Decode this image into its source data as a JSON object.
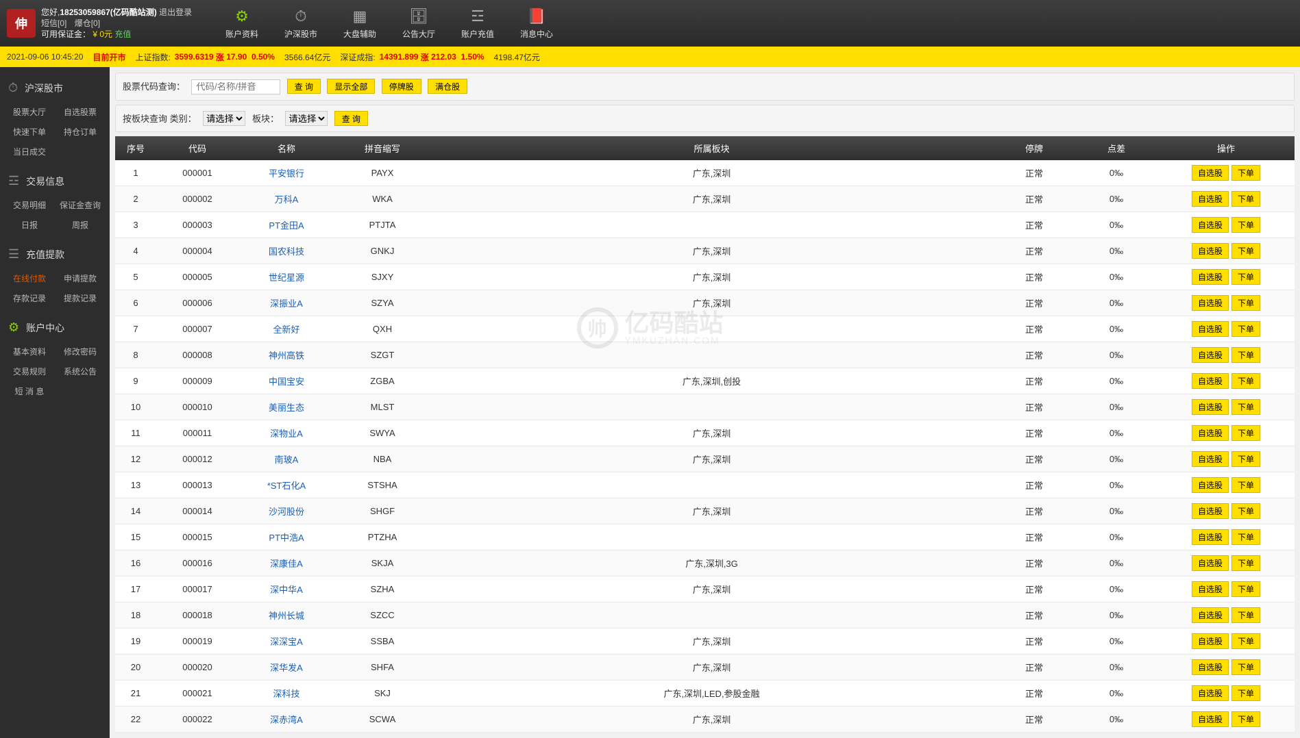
{
  "header": {
    "greeting_prefix": "您好,",
    "username": "18253059867(亿码酷站测)",
    "logout": "退出登录",
    "sms_label": "短信[0]",
    "hold_label": "爆仓[0]",
    "margin_label": "可用保证金：",
    "margin_value": "¥ 0元",
    "recharge": "充值"
  },
  "topnav": [
    {
      "icon": "⚙",
      "label": "账户资料"
    },
    {
      "icon": "⏱",
      "label": "沪深股市"
    },
    {
      "icon": "▦",
      "label": "大盘辅助"
    },
    {
      "icon": "🗄",
      "label": "公告大厅"
    },
    {
      "icon": "☲",
      "label": "账户充值"
    },
    {
      "icon": "📕",
      "label": "消息中心"
    }
  ],
  "ticker": {
    "date_time": "2021-09-06 10:45:20",
    "market_status": "目前开市",
    "sh_label": "上证指数:",
    "sh_index": "3599.6319",
    "sh_up": "涨",
    "sh_chg": "17.90",
    "sh_pct": "0.50%",
    "sh_amt": "3566.64亿元",
    "sz_label": "深证成指:",
    "sz_index": "14391.899",
    "sz_up": "涨",
    "sz_chg": "212.03",
    "sz_pct": "1.50%",
    "sz_amt": "4198.47亿元"
  },
  "sidebar": {
    "cat1": "沪深股市",
    "links1": [
      "股票大厅",
      "自选股票",
      "快速下单",
      "持仓订单",
      "当日成交"
    ],
    "cat2": "交易信息",
    "links2": [
      "交易明细",
      "保证金查询",
      "日报",
      "周报"
    ],
    "cat3": "充值提款",
    "links3": [
      "在线付款",
      "申请提款",
      "存款记录",
      "提款记录"
    ],
    "cat4": "账户中心",
    "links4": [
      "基本资料",
      "修改密码",
      "交易规则",
      "系统公告",
      "短 消 息"
    ]
  },
  "search": {
    "label1": "股票代码查询：",
    "placeholder": "代码/名称/拼音",
    "btn_query": "查 询",
    "btn_all": "显示全部",
    "btn_suspend": "停牌股",
    "btn_full": "满仓股",
    "label2": "按板块查询 类别：",
    "sel1": "请选择",
    "label3": "板块：",
    "sel2": "请选择",
    "btn_query2": "查 询"
  },
  "table": {
    "headers": [
      "序号",
      "代码",
      "名称",
      "拼音缩写",
      "所属板块",
      "停牌",
      "点差",
      "操作"
    ],
    "op_fav": "自选股",
    "op_order": "下单",
    "rows": [
      {
        "n": "1",
        "code": "000001",
        "name": "平安银行",
        "py": "PAYX",
        "sector": "广东,深圳",
        "status": "正常",
        "spread": "0‰"
      },
      {
        "n": "2",
        "code": "000002",
        "name": "万科A",
        "py": "WKA",
        "sector": "广东,深圳",
        "status": "正常",
        "spread": "0‰"
      },
      {
        "n": "3",
        "code": "000003",
        "name": "PT金田A",
        "py": "PTJTA",
        "sector": "",
        "status": "正常",
        "spread": "0‰"
      },
      {
        "n": "4",
        "code": "000004",
        "name": "国农科技",
        "py": "GNKJ",
        "sector": "广东,深圳",
        "status": "正常",
        "spread": "0‰"
      },
      {
        "n": "5",
        "code": "000005",
        "name": "世纪星源",
        "py": "SJXY",
        "sector": "广东,深圳",
        "status": "正常",
        "spread": "0‰"
      },
      {
        "n": "6",
        "code": "000006",
        "name": "深振业A",
        "py": "SZYA",
        "sector": "广东,深圳",
        "status": "正常",
        "spread": "0‰"
      },
      {
        "n": "7",
        "code": "000007",
        "name": "全新好",
        "py": "QXH",
        "sector": "",
        "status": "正常",
        "spread": "0‰"
      },
      {
        "n": "8",
        "code": "000008",
        "name": "神州高铁",
        "py": "SZGT",
        "sector": "",
        "status": "正常",
        "spread": "0‰"
      },
      {
        "n": "9",
        "code": "000009",
        "name": "中国宝安",
        "py": "ZGBA",
        "sector": "广东,深圳,创投",
        "status": "正常",
        "spread": "0‰"
      },
      {
        "n": "10",
        "code": "000010",
        "name": "美丽生态",
        "py": "MLST",
        "sector": "",
        "status": "正常",
        "spread": "0‰"
      },
      {
        "n": "11",
        "code": "000011",
        "name": "深物业A",
        "py": "SWYA",
        "sector": "广东,深圳",
        "status": "正常",
        "spread": "0‰"
      },
      {
        "n": "12",
        "code": "000012",
        "name": "南玻A",
        "py": "NBA",
        "sector": "广东,深圳",
        "status": "正常",
        "spread": "0‰"
      },
      {
        "n": "13",
        "code": "000013",
        "name": "*ST石化A",
        "py": "STSHA",
        "sector": "",
        "status": "正常",
        "spread": "0‰"
      },
      {
        "n": "14",
        "code": "000014",
        "name": "沙河股份",
        "py": "SHGF",
        "sector": "广东,深圳",
        "status": "正常",
        "spread": "0‰"
      },
      {
        "n": "15",
        "code": "000015",
        "name": "PT中浩A",
        "py": "PTZHA",
        "sector": "",
        "status": "正常",
        "spread": "0‰"
      },
      {
        "n": "16",
        "code": "000016",
        "name": "深康佳A",
        "py": "SKJA",
        "sector": "广东,深圳,3G",
        "status": "正常",
        "spread": "0‰"
      },
      {
        "n": "17",
        "code": "000017",
        "name": "深中华A",
        "py": "SZHA",
        "sector": "广东,深圳",
        "status": "正常",
        "spread": "0‰"
      },
      {
        "n": "18",
        "code": "000018",
        "name": "神州长城",
        "py": "SZCC",
        "sector": "",
        "status": "正常",
        "spread": "0‰"
      },
      {
        "n": "19",
        "code": "000019",
        "name": "深深宝A",
        "py": "SSBA",
        "sector": "广东,深圳",
        "status": "正常",
        "spread": "0‰"
      },
      {
        "n": "20",
        "code": "000020",
        "name": "深华发A",
        "py": "SHFA",
        "sector": "广东,深圳",
        "status": "正常",
        "spread": "0‰"
      },
      {
        "n": "21",
        "code": "000021",
        "name": "深科技",
        "py": "SKJ",
        "sector": "广东,深圳,LED,参股金融",
        "status": "正常",
        "spread": "0‰"
      },
      {
        "n": "22",
        "code": "000022",
        "name": "深赤湾A",
        "py": "SCWA",
        "sector": "广东,深圳",
        "status": "正常",
        "spread": "0‰"
      }
    ]
  },
  "watermark": {
    "cn": "亿码酷站",
    "en": "YMKUZHAN.COM"
  }
}
